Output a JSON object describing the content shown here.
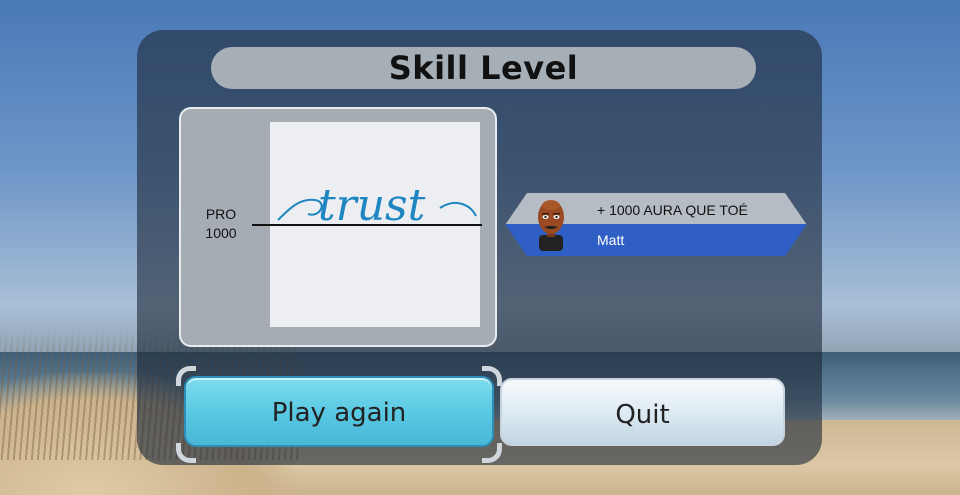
{
  "title": "Skill Level",
  "rank": {
    "tier": "PRO",
    "points": "1000"
  },
  "image_word": "trust",
  "player": {
    "status": "+ 1000 AURA QUE TOÉ",
    "name": "Matt"
  },
  "buttons": {
    "play_again": "Play again",
    "quit": "Quit"
  },
  "colors": {
    "selected_button": "#5ac9e3",
    "player_bar": "#2f5fc4",
    "script_word": "#1f86c2"
  }
}
